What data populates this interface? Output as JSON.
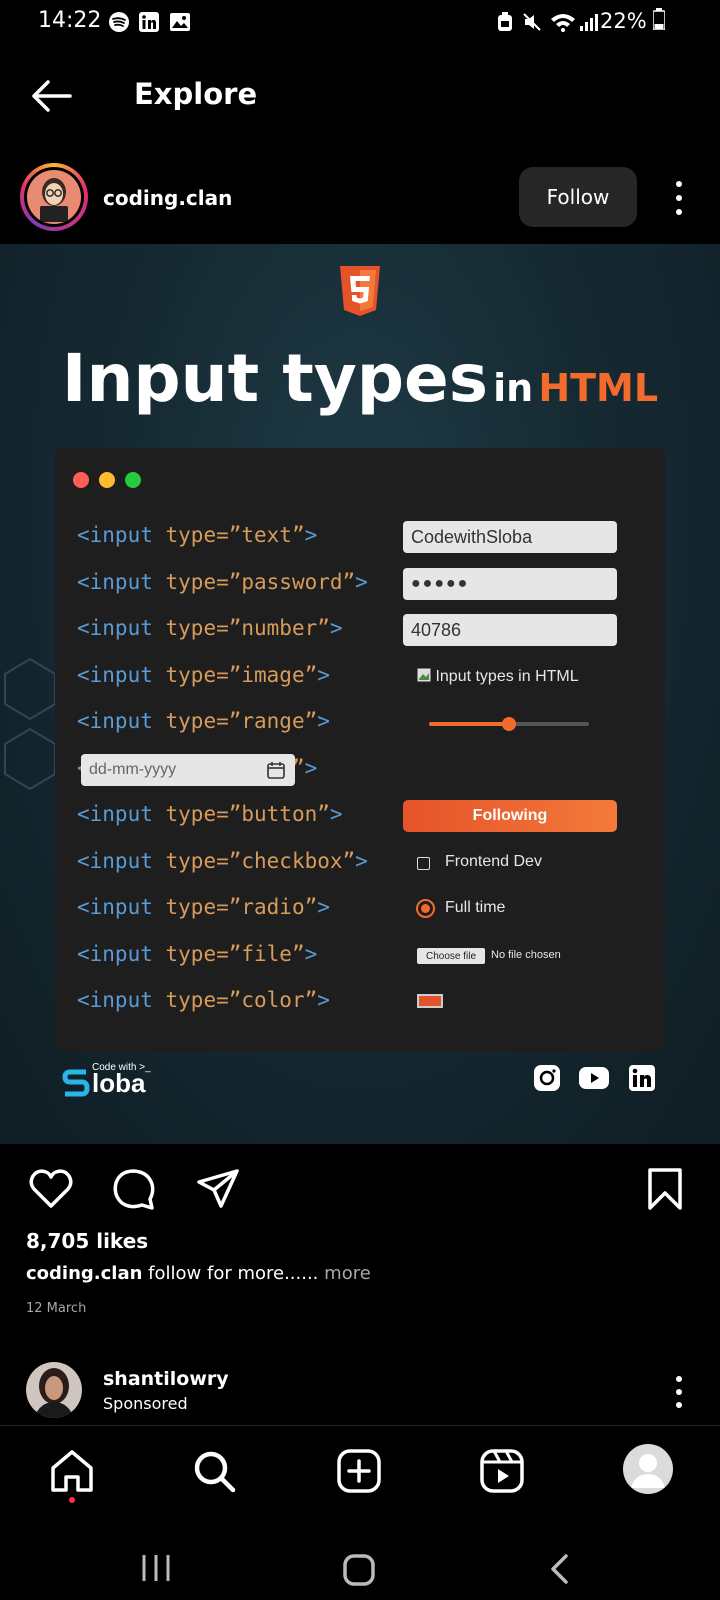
{
  "status_bar": {
    "time": "14:22",
    "battery": "22%"
  },
  "header": {
    "title": "Explore"
  },
  "post": {
    "username": "coding.clan",
    "follow_label": "Follow",
    "image": {
      "title_main": "Input types",
      "title_in": "in",
      "title_html": "HTML",
      "rows": [
        {
          "type": "text"
        },
        {
          "type": "password"
        },
        {
          "type": "number"
        },
        {
          "type": "image"
        },
        {
          "type": "range"
        },
        {
          "type": "date"
        },
        {
          "type": "button"
        },
        {
          "type": "checkbox"
        },
        {
          "type": "radio"
        },
        {
          "type": "file"
        },
        {
          "type": "color"
        }
      ],
      "code_prefix": "<input ",
      "code_attr": "type=",
      "text_value": "CodewithSloba",
      "password_value": "●●●●●",
      "number_value": "40786",
      "image_alt": "Input types in HTML",
      "range_value_percent": 50,
      "date_placeholder": "dd-mm-yyyy",
      "button_label": "Following",
      "checkbox_label": "Frontend Dev",
      "radio_label": "Full time",
      "file_button": "Choose file",
      "file_status": "No file chosen",
      "color_value": "#e5532a",
      "brand_small": "Code with >_",
      "brand_name": "loba"
    },
    "likes": "8,705 likes",
    "caption_user": "coding.clan",
    "caption_text": "follow for more......",
    "caption_more": "more",
    "date": "12 March"
  },
  "next_post": {
    "username": "shantilowry",
    "subtitle": "Sponsored"
  },
  "colors": {
    "accent": "#f36b2c",
    "notification": "#ff3040"
  }
}
